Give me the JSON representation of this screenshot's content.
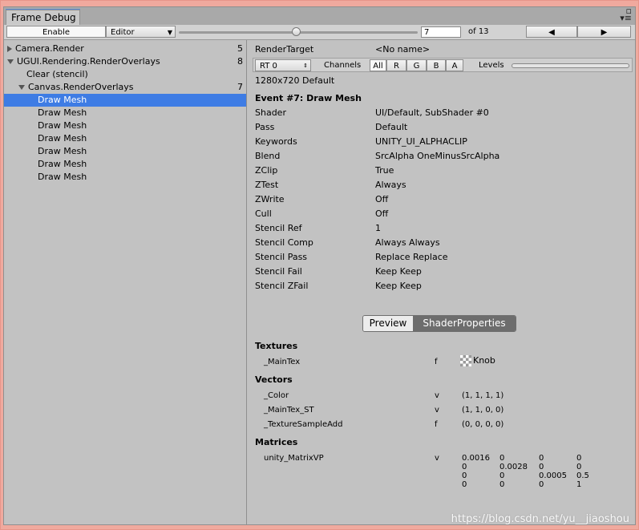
{
  "window": {
    "title": "Frame Debug"
  },
  "toolbar": {
    "enable_label": "Enable",
    "editor_label": "Editor",
    "frame_value": "7",
    "frame_total": "of 13",
    "prev_icon": "◀",
    "next_icon": "▶",
    "slider_fraction": 0.49
  },
  "tree": [
    {
      "label": "Camera.Render",
      "count": "5",
      "indent": 0,
      "arrow": "right",
      "selected": false
    },
    {
      "label": "UGUI.Rendering.RenderOverlays",
      "count": "8",
      "indent": 0,
      "arrow": "down",
      "selected": false
    },
    {
      "label": "Clear (stencil)",
      "count": "",
      "indent": 1,
      "arrow": "",
      "selected": false
    },
    {
      "label": "Canvas.RenderOverlays",
      "count": "7",
      "indent": 1,
      "arrow": "down",
      "selected": false
    },
    {
      "label": "Draw Mesh",
      "count": "",
      "indent": 2,
      "arrow": "",
      "selected": true
    },
    {
      "label": "Draw Mesh",
      "count": "",
      "indent": 2,
      "arrow": "",
      "selected": false
    },
    {
      "label": "Draw Mesh",
      "count": "",
      "indent": 2,
      "arrow": "",
      "selected": false
    },
    {
      "label": "Draw Mesh",
      "count": "",
      "indent": 2,
      "arrow": "",
      "selected": false
    },
    {
      "label": "Draw Mesh",
      "count": "",
      "indent": 2,
      "arrow": "",
      "selected": false
    },
    {
      "label": "Draw Mesh",
      "count": "",
      "indent": 2,
      "arrow": "",
      "selected": false
    },
    {
      "label": "Draw Mesh",
      "count": "",
      "indent": 2,
      "arrow": "",
      "selected": false
    }
  ],
  "detail": {
    "render_target_label": "RenderTarget",
    "render_target_value": "<No name>",
    "rt_select": "RT 0",
    "channels_label": "Channels",
    "channels": [
      "All",
      "R",
      "G",
      "B",
      "A"
    ],
    "levels_label": "Levels",
    "resolution": "1280x720 Default",
    "event_title": "Event #7: Draw Mesh",
    "props": [
      {
        "k": "Shader",
        "v": "UI/Default, SubShader #0"
      },
      {
        "k": "Pass",
        "v": "Default"
      },
      {
        "k": "Keywords",
        "v": "UNITY_UI_ALPHACLIP"
      },
      {
        "k": "Blend",
        "v": "SrcAlpha OneMinusSrcAlpha"
      },
      {
        "k": "ZClip",
        "v": "True"
      },
      {
        "k": "ZTest",
        "v": "Always"
      },
      {
        "k": "ZWrite",
        "v": "Off"
      },
      {
        "k": "Cull",
        "v": "Off"
      },
      {
        "k": "Stencil Ref",
        "v": "1"
      },
      {
        "k": "Stencil Comp",
        "v": "Always Always"
      },
      {
        "k": "Stencil Pass",
        "v": "Replace Replace"
      },
      {
        "k": "Stencil Fail",
        "v": "Keep Keep"
      },
      {
        "k": "Stencil ZFail",
        "v": "Keep Keep"
      }
    ],
    "preview_tab": "Preview",
    "shaderprops_tab": "ShaderProperties",
    "textures_title": "Textures",
    "textures": [
      {
        "name": "_MainTex",
        "stage": "f",
        "value": "Knob"
      }
    ],
    "vectors_title": "Vectors",
    "vectors": [
      {
        "name": "_Color",
        "stage": "v",
        "value": "(1, 1, 1, 1)"
      },
      {
        "name": "_MainTex_ST",
        "stage": "v",
        "value": "(1, 1, 0, 0)"
      },
      {
        "name": "_TextureSampleAdd",
        "stage": "f",
        "value": "(0, 0, 0, 0)"
      }
    ],
    "matrices_title": "Matrices",
    "matrix": {
      "name": "unity_MatrixVP",
      "stage": "v",
      "rows": [
        [
          "0.0016",
          "0",
          "0",
          "0"
        ],
        [
          "0",
          "0.0028",
          "0",
          "0"
        ],
        [
          "0",
          "0",
          "0.0005",
          "0.5"
        ],
        [
          "0",
          "0",
          "0",
          "1"
        ]
      ]
    }
  },
  "watermark": "https://blog.csdn.net/yu__jiaoshou",
  "colors": {
    "selection": "#3e7ce4",
    "accent_tab": "#5b8cd6",
    "frame_border": "#f0a99e"
  }
}
